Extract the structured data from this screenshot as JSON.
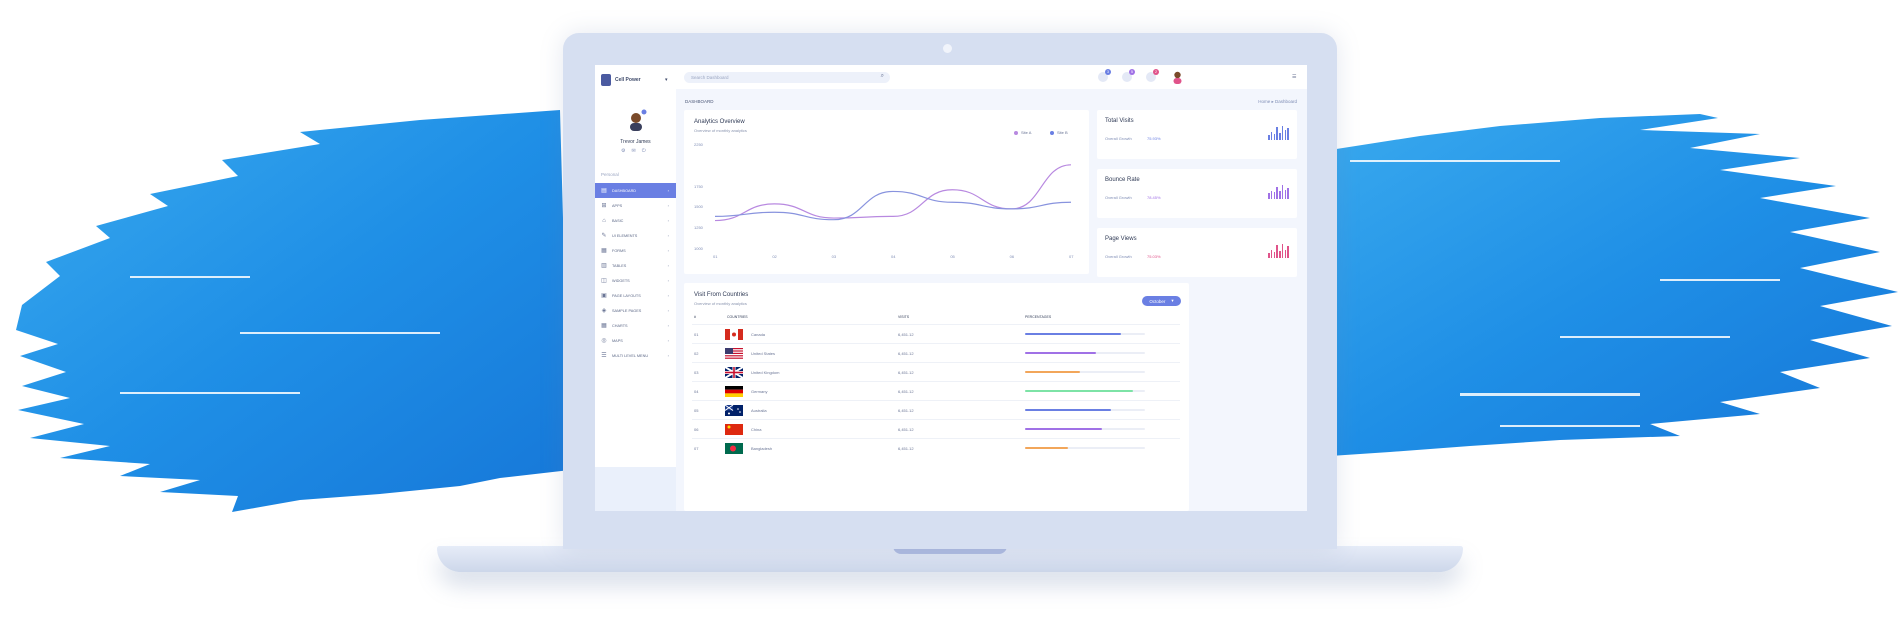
{
  "colors": {
    "accent": "#6a7fe3",
    "purple": "#a071e6",
    "pink": "#e0538a",
    "line_a": "#b889e0",
    "line_b": "#8893de"
  },
  "sidebar": {
    "brand": "Cell Power",
    "user_name": "Trevor James",
    "section_label": "Personal",
    "items": [
      {
        "label": "DASHBOARD",
        "icon": "dashboard-icon",
        "active": true
      },
      {
        "label": "APPS",
        "icon": "apps-icon"
      },
      {
        "label": "BASIC",
        "icon": "basic-icon"
      },
      {
        "label": "UI ELEMENTS",
        "icon": "ui-elements-icon"
      },
      {
        "label": "FORMS",
        "icon": "forms-icon"
      },
      {
        "label": "TABLES",
        "icon": "tables-icon"
      },
      {
        "label": "WIDGETS",
        "icon": "widgets-icon"
      },
      {
        "label": "PAGE LAYOUTS",
        "icon": "page-layouts-icon"
      },
      {
        "label": "SAMPLE PAGES",
        "icon": "sample-pages-icon"
      },
      {
        "label": "CHARTS",
        "icon": "charts-icon"
      },
      {
        "label": "MAPS",
        "icon": "maps-icon"
      },
      {
        "label": "MULTI LEVEL MENU",
        "icon": "multi-level-menu-icon"
      }
    ]
  },
  "topbar": {
    "search_placeholder": "Search Dashboard",
    "badges": [
      {
        "count": "3",
        "color": "#6a7fe3"
      },
      {
        "count": "5",
        "color": "#a071e6"
      },
      {
        "count": "2",
        "color": "#e0538a"
      }
    ]
  },
  "breadcrumb": {
    "title": "DASHBOARD",
    "path": "Home  ▸  Dashboard"
  },
  "analytics": {
    "title": "Analytics Overview",
    "subtitle": "Overview of monthly analytics",
    "legend": [
      "Site A",
      "Site B"
    ]
  },
  "chart_data": {
    "type": "line",
    "x": [
      "01",
      "02",
      "03",
      "04",
      "05",
      "06",
      "07"
    ],
    "y_ticks": [
      "2250",
      "1750",
      "1500",
      "1250",
      "1000"
    ],
    "ylim": [
      1000,
      2250
    ],
    "grid": false,
    "legend_position": "top-right",
    "series": [
      {
        "name": "Site A",
        "color": "#b889e0",
        "values": [
          1330,
          1530,
          1360,
          1380,
          1700,
          1470,
          2000
        ]
      },
      {
        "name": "Site B",
        "color": "#8893de",
        "values": [
          1380,
          1430,
          1340,
          1680,
          1550,
          1470,
          1550
        ]
      }
    ]
  },
  "stats": [
    {
      "title": "Total Visits",
      "label": "Overall Growth",
      "value": "75.93%",
      "color": "#6a7fe3",
      "bars": [
        0.35,
        0.55,
        0.45,
        0.9,
        0.5,
        1.0,
        0.7,
        0.85
      ]
    },
    {
      "title": "Bounce Rate",
      "label": "Overall Growth",
      "value": "78.45%",
      "color": "#a071e6",
      "bars": [
        0.4,
        0.6,
        0.5,
        0.85,
        0.55,
        1.0,
        0.65,
        0.8
      ]
    },
    {
      "title": "Page Views",
      "label": "Overall Growth",
      "value": "75.03%",
      "color": "#e0538a",
      "bars": [
        0.35,
        0.6,
        0.45,
        0.9,
        0.5,
        1.0,
        0.6,
        0.85
      ]
    }
  ],
  "countries": {
    "title": "Visit From Countries",
    "subtitle": "Overview of monthly analytics",
    "button": "October",
    "headers": [
      "#",
      "COUNTRIES",
      "VISITS",
      "PERCENTAGES"
    ],
    "rows": [
      {
        "num": "01",
        "country": "Canada",
        "visits": "6,451.12",
        "pct": 0.8,
        "color": "#6a7fe3",
        "flag": "ca"
      },
      {
        "num": "02",
        "country": "United States",
        "visits": "6,451.12",
        "pct": 0.59,
        "color": "#a071e6",
        "flag": "us"
      },
      {
        "num": "03",
        "country": "United Kingdom",
        "visits": "6,451.12",
        "pct": 0.46,
        "color": "#f2a65a",
        "flag": "gb"
      },
      {
        "num": "04",
        "country": "Germany",
        "visits": "6,451.12",
        "pct": 0.9,
        "color": "#7de3a6",
        "flag": "de"
      },
      {
        "num": "05",
        "country": "Australia",
        "visits": "6,451.12",
        "pct": 0.72,
        "color": "#6a7fe3",
        "flag": "au"
      },
      {
        "num": "06",
        "country": "China",
        "visits": "6,451.12",
        "pct": 0.64,
        "color": "#a071e6",
        "flag": "cn"
      },
      {
        "num": "07",
        "country": "Bangladesh",
        "visits": "6,451.12",
        "pct": 0.36,
        "color": "#f2a65a",
        "flag": "bd"
      }
    ]
  }
}
